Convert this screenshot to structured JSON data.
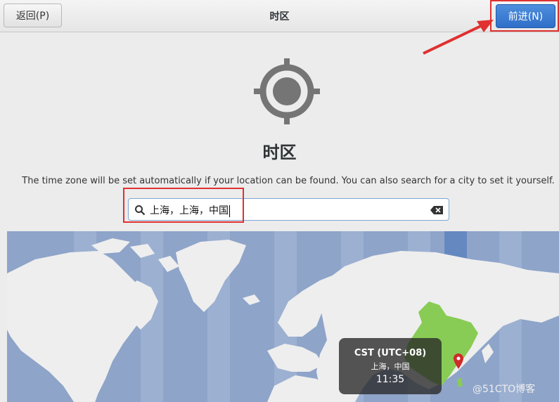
{
  "header": {
    "back_label": "返回(P)",
    "title": "时区",
    "next_label": "前进(N)"
  },
  "main": {
    "title": "时区",
    "description": "The time zone will be set automatically if your location can be found. You can also search for a city to set it yourself."
  },
  "search": {
    "value": "上海，上海，中国"
  },
  "tooltip": {
    "zone": "CST (UTC+08)",
    "city": "上海，中国",
    "time": "11:35"
  },
  "watermark": "@51CTO博客",
  "icons": [
    "locate-icon",
    "search-icon",
    "clear-text-icon",
    "location-pin-icon"
  ],
  "colors": {
    "accent": "#3a7bd5",
    "highlight_region": "#88cc55",
    "ocean": "#8ea4c9",
    "annotation_red": "#e03030"
  }
}
